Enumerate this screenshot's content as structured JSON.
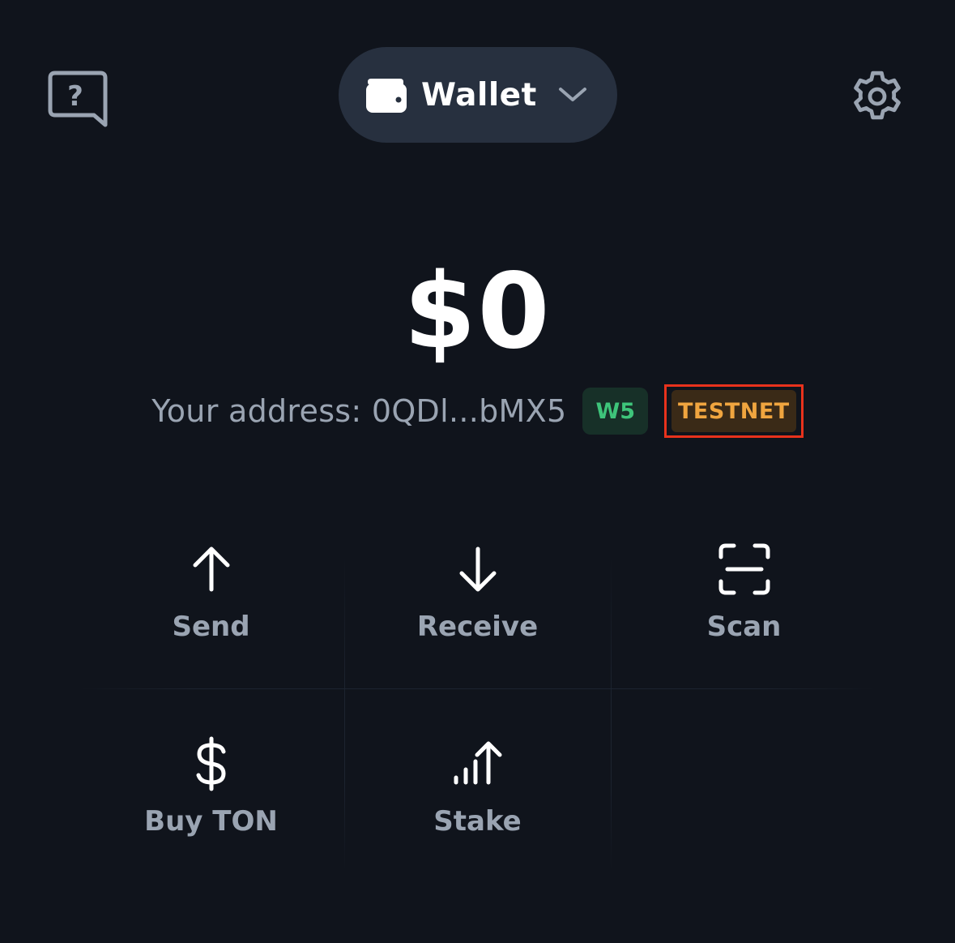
{
  "header": {
    "help_icon": "question-bubble-icon",
    "wallet_icon": "wallet-icon",
    "wallet_label": "Wallet",
    "chevron_icon": "chevron-down-icon",
    "settings_icon": "gear-icon"
  },
  "balance": {
    "value": "$0"
  },
  "address": {
    "text": "Your address: 0QDl...bMX5",
    "version_badge": "W5",
    "network_badge": "TESTNET"
  },
  "actions": [
    {
      "label": "Send",
      "icon": "arrow-up-icon"
    },
    {
      "label": "Receive",
      "icon": "arrow-down-icon"
    },
    {
      "label": "Scan",
      "icon": "scan-icon"
    },
    {
      "label": "Buy TON",
      "icon": "dollar-icon"
    },
    {
      "label": "Stake",
      "icon": "stake-icon"
    }
  ],
  "colors": {
    "background": "#10141c",
    "pill": "#27303f",
    "muted_text": "#9aa4b2",
    "w5_badge_text": "#3ec47a",
    "testnet_badge_text": "#f0a53f",
    "highlight_border": "#e8321c"
  }
}
